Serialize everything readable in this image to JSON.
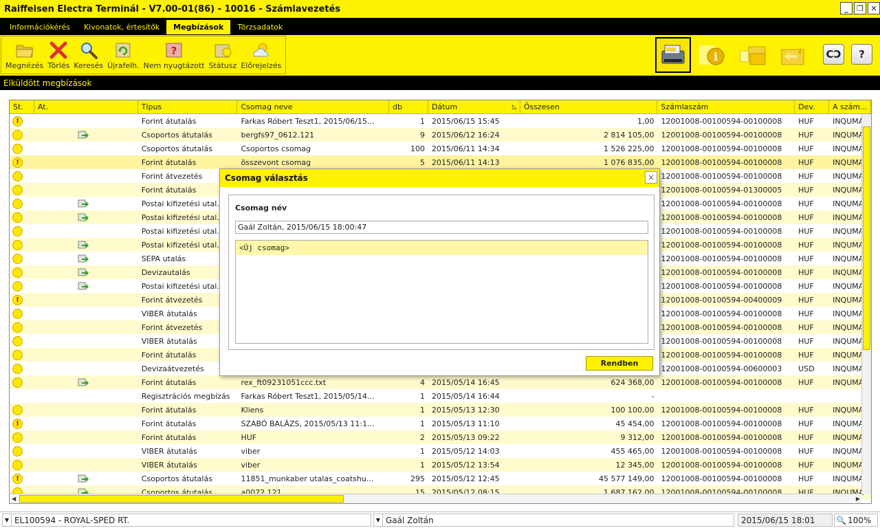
{
  "window": {
    "title": "Raiffeisen Electra Terminál - V7.00-01(86) - 10016 - Számlavezetés",
    "minimize": "_",
    "restore": "❐",
    "close": "✕"
  },
  "menu": [
    {
      "label": "Információkérés",
      "active": false
    },
    {
      "label": "Kivonatok, értesítők",
      "active": false
    },
    {
      "label": "Megbízások",
      "active": true
    },
    {
      "label": "Törzsadatok",
      "active": false
    }
  ],
  "toolbar": {
    "tools": [
      {
        "label": "Megnézés",
        "icon": "folder-open-icon"
      },
      {
        "label": "Törlés",
        "icon": "delete-x-icon"
      },
      {
        "label": "Keresés",
        "icon": "magnifier-icon"
      },
      {
        "label": "Újrafelh.",
        "icon": "reuse-icon"
      },
      {
        "label": "Nem nyugtázott",
        "icon": "unconfirmed-icon"
      },
      {
        "label": "Státusz",
        "icon": "status-icon"
      },
      {
        "label": "Előrejelzés",
        "icon": "forecast-icon"
      }
    ],
    "right": [
      {
        "icon": "transfer-machine-icon",
        "selected": true
      },
      {
        "icon": "info-icon",
        "selected": false
      },
      {
        "icon": "folders-icon",
        "selected": false
      },
      {
        "icon": "folder-sync-icon",
        "selected": false
      }
    ],
    "link_button": "CƆ",
    "help_button": "?"
  },
  "section_title": "Elküldött megbízások",
  "table": {
    "columns": [
      "St.",
      "At.",
      "Típus",
      "Csomag neve",
      "db",
      "Dátum",
      "Összesen",
      "Számlaszám",
      "Dev.",
      "A szám..."
    ],
    "sorted_column": "Dátum",
    "rows": [
      {
        "st": "warn",
        "at": false,
        "tipus": "Forint átutalás",
        "csomag": "Farkas Róbert Teszt1, 2015/06/15...",
        "db": "1",
        "datum": "2015/06/15  15:45",
        "osszesen": "1,00",
        "szamla": "12001008-00100594-00100008",
        "dev": "HUF",
        "aszam": "INQUMA"
      },
      {
        "st": "ok",
        "at": true,
        "tipus": "Csoportos átutalás",
        "csomag": "bergfs97_0612.121",
        "db": "9",
        "datum": "2015/06/12  16:24",
        "osszesen": "2 814 105,00",
        "szamla": "12001008-00100594-00100008",
        "dev": "HUF",
        "aszam": "INQUMA"
      },
      {
        "st": "ok",
        "at": false,
        "tipus": "Csoportos átutalás",
        "csomag": "Csoportos csomag",
        "db": "100",
        "datum": "2015/06/11  14:34",
        "osszesen": "1 526 225,00",
        "szamla": "12001008-00100594-00100008",
        "dev": "HUF",
        "aszam": "INQUMA"
      },
      {
        "st": "warn",
        "at": false,
        "tipus": "Forint átutalás",
        "csomag": "összevont csomag",
        "db": "5",
        "datum": "2015/06/11  14:13",
        "osszesen": "1 076 835,00",
        "szamla": "12001008-00100594-00100008",
        "dev": "HUF",
        "aszam": "INQUMA"
      },
      {
        "st": "ok",
        "at": false,
        "tipus": "Forint átvezetés",
        "csomag": "",
        "db": "",
        "datum": "",
        "osszesen": "",
        "szamla": "12001008-00100594-00100008",
        "dev": "HUF",
        "aszam": "INQUMA"
      },
      {
        "st": "ok",
        "at": false,
        "tipus": "Forint átutalás",
        "csomag": "",
        "db": "",
        "datum": "",
        "osszesen": "",
        "szamla": "12001008-00100594-01300005",
        "dev": "HUF",
        "aszam": "INQUMA"
      },
      {
        "st": "ok",
        "at": true,
        "tipus": "Postai kifizetési utal.",
        "csomag": "",
        "db": "",
        "datum": "",
        "osszesen": "",
        "szamla": "12001008-00100594-00100008",
        "dev": "HUF",
        "aszam": "INQUMA"
      },
      {
        "st": "ok",
        "at": true,
        "tipus": "Postai kifizetési utal.",
        "csomag": "",
        "db": "",
        "datum": "",
        "osszesen": "",
        "szamla": "12001008-00100594-00100008",
        "dev": "HUF",
        "aszam": "INQUMA"
      },
      {
        "st": "ok",
        "at": false,
        "tipus": "Postai kifizetési utal.",
        "csomag": "",
        "db": "",
        "datum": "",
        "osszesen": "",
        "szamla": "12001008-00100594-00100008",
        "dev": "HUF",
        "aszam": "INQUMA"
      },
      {
        "st": "ok",
        "at": true,
        "tipus": "Postai kifizetési utal.",
        "csomag": "",
        "db": "",
        "datum": "",
        "osszesen": "",
        "szamla": "12001008-00100594-00100008",
        "dev": "HUF",
        "aszam": "INQUMA"
      },
      {
        "st": "ok",
        "at": true,
        "tipus": "SEPA utalás",
        "csomag": "",
        "db": "",
        "datum": "",
        "osszesen": "",
        "szamla": "12001008-00100594-00100008",
        "dev": "HUF",
        "aszam": "INQUMA"
      },
      {
        "st": "ok",
        "at": true,
        "tipus": "Devizautalás",
        "csomag": "",
        "db": "",
        "datum": "",
        "osszesen": "",
        "szamla": "12001008-00100594-00100008",
        "dev": "HUF",
        "aszam": "INQUMA"
      },
      {
        "st": "ok",
        "at": true,
        "tipus": "Postai kifizetési utal.",
        "csomag": "",
        "db": "",
        "datum": "",
        "osszesen": "",
        "szamla": "12001008-00100594-00100008",
        "dev": "HUF",
        "aszam": "INQUMA"
      },
      {
        "st": "warn",
        "at": false,
        "tipus": "Forint átvezetés",
        "csomag": "",
        "db": "",
        "datum": "",
        "osszesen": "",
        "szamla": "12001008-00100594-00400009",
        "dev": "HUF",
        "aszam": "INQUMA"
      },
      {
        "st": "ok",
        "at": false,
        "tipus": "VIBER átutalás",
        "csomag": "",
        "db": "",
        "datum": "",
        "osszesen": "",
        "szamla": "12001008-00100594-00100008",
        "dev": "HUF",
        "aszam": "INQUMA"
      },
      {
        "st": "ok",
        "at": false,
        "tipus": "Forint átvezetés",
        "csomag": "",
        "db": "",
        "datum": "",
        "osszesen": "",
        "szamla": "12001008-00100594-00100008",
        "dev": "HUF",
        "aszam": "INQUMA"
      },
      {
        "st": "ok",
        "at": false,
        "tipus": "VIBER átutalás",
        "csomag": "",
        "db": "",
        "datum": "",
        "osszesen": "",
        "szamla": "12001008-00100594-00100008",
        "dev": "HUF",
        "aszam": "INQUMA"
      },
      {
        "st": "ok",
        "at": false,
        "tipus": "Forint átutalás",
        "csomag": "",
        "db": "",
        "datum": "",
        "osszesen": "",
        "szamla": "12001008-00100594-00100008",
        "dev": "HUF",
        "aszam": "INQUMA"
      },
      {
        "st": "ok",
        "at": false,
        "tipus": "Devizaátvezetés",
        "csomag": "",
        "db": "",
        "datum": "",
        "osszesen": "",
        "szamla": "12001008-00100594-00600003",
        "dev": "USD",
        "aszam": "INQUMA"
      },
      {
        "st": "ok",
        "at": true,
        "tipus": "Forint átutalás",
        "csomag": "rex_ft09231051ccc.txt",
        "db": "4",
        "datum": "2015/05/14  16:45",
        "osszesen": "624 368,00",
        "szamla": "12001008-00100594-00100008",
        "dev": "HUF",
        "aszam": "INQUMA"
      },
      {
        "st": "none",
        "at": false,
        "tipus": "Regisztrációs megbízás",
        "csomag": "Farkas Róbert Teszt1, 2015/05/14...",
        "db": "1",
        "datum": "2015/05/14  16:44",
        "osszesen": "-",
        "szamla": "",
        "dev": "",
        "aszam": ""
      },
      {
        "st": "ok",
        "at": false,
        "tipus": "Forint átutalás",
        "csomag": "Kliens",
        "db": "1",
        "datum": "2015/05/13  12:30",
        "osszesen": "100 100,00",
        "szamla": "12001008-00100594-00100008",
        "dev": "HUF",
        "aszam": "INQUMA"
      },
      {
        "st": "warn",
        "at": false,
        "tipus": "Forint átutalás",
        "csomag": "SZABÓ BALÁZS, 2015/05/13 11:1...",
        "db": "1",
        "datum": "2015/05/13  11:10",
        "osszesen": "45 454,00",
        "szamla": "12001008-00100594-00100008",
        "dev": "HUF",
        "aszam": "INQUMA"
      },
      {
        "st": "ok",
        "at": false,
        "tipus": "Forint átutalás",
        "csomag": "HUF",
        "db": "2",
        "datum": "2015/05/13  09:22",
        "osszesen": "9 312,00",
        "szamla": "12001008-00100594-00100008",
        "dev": "HUF",
        "aszam": "INQUMA"
      },
      {
        "st": "ok",
        "at": false,
        "tipus": "VIBER átutalás",
        "csomag": "viber",
        "db": "1",
        "datum": "2015/05/12  14:03",
        "osszesen": "455 465,00",
        "szamla": "12001008-00100594-00100008",
        "dev": "HUF",
        "aszam": "INQUMA"
      },
      {
        "st": "ok",
        "at": false,
        "tipus": "VIBER átutalás",
        "csomag": "viber",
        "db": "1",
        "datum": "2015/05/12  13:54",
        "osszesen": "12 345,00",
        "szamla": "12001008-00100594-00100008",
        "dev": "HUF",
        "aszam": "INQUMA"
      },
      {
        "st": "warn",
        "at": true,
        "tipus": "Csoportos átutalás",
        "csomag": "11851_munkaber utalas_coatshu...",
        "db": "295",
        "datum": "2015/05/12  12:45",
        "osszesen": "45 577 149,00",
        "szamla": "12001008-00100594-00100008",
        "dev": "HUF",
        "aszam": "INQUMA"
      },
      {
        "st": "ok",
        "at": true,
        "tipus": "Csoportos átutalás",
        "csomag": "a0072.121",
        "db": "15",
        "datum": "2015/05/12  08:15",
        "osszesen": "1 687 162,00",
        "szamla": "12001008-00100594-00100008",
        "dev": "HUF",
        "aszam": "INQUMA"
      }
    ]
  },
  "dialog": {
    "title": "Csomag választás",
    "close": "×",
    "label": "Csomag név",
    "input_value": "Gaál Zoltán, 2015/06/15 18:00:47",
    "list_items": [
      "<Új csomag>"
    ],
    "ok_button": "Rendben"
  },
  "statusbar": {
    "company": "EL100594 - ROYAL-SPED RT.",
    "user": "Gaál Zoltán",
    "datetime": "2015/06/15 18:01",
    "zoom": "100%"
  }
}
